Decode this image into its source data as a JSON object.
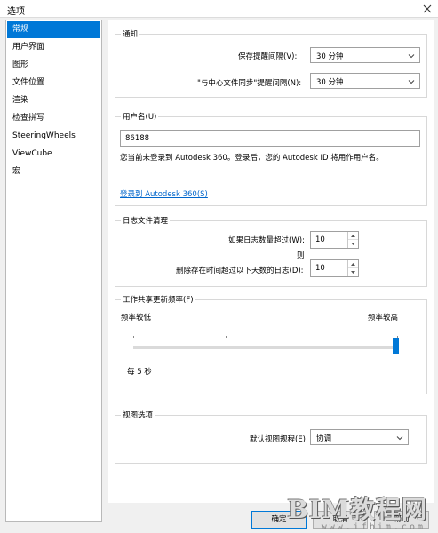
{
  "window": {
    "title": "选项"
  },
  "sidebar": {
    "items": [
      {
        "label": "常规"
      },
      {
        "label": "用户界面"
      },
      {
        "label": "图形"
      },
      {
        "label": "文件位置"
      },
      {
        "label": "渲染"
      },
      {
        "label": "检查拼写"
      },
      {
        "label": "SteeringWheels"
      },
      {
        "label": "ViewCube"
      },
      {
        "label": "宏"
      }
    ],
    "selected": "常规"
  },
  "notify": {
    "title": "通知",
    "save_reminder_label": "保存提醒间隔(V):",
    "save_reminder_value": "30 分钟",
    "sync_reminder_label": "\"与中心文件同步\"提醒间隔(N):",
    "sync_reminder_value": "30 分钟"
  },
  "username": {
    "title": "用户名(U)",
    "value": "86188",
    "message": "您当前未登录到 Autodesk 360。登录后，您的 Autodesk ID 将用作用户名。",
    "login_link": "登录到 Autodesk 360(S)"
  },
  "journal": {
    "title": "日志文件清理",
    "count_label": "如果日志数量超过(W):",
    "count_value": "10",
    "then_label": "则",
    "days_label": "删除存在时间超过以下天数的日志(D):",
    "days_value": "10"
  },
  "worksharing": {
    "title": "工作共享更新频率(F)",
    "low_label": "频率较低",
    "high_label": "频率较高",
    "slider_fraction": 1.0,
    "status": "每 5 秒"
  },
  "view_options": {
    "title": "视图选项",
    "discipline_label": "默认视图规程(E):",
    "discipline_value": "协调"
  },
  "buttons": {
    "ok": "确定",
    "cancel": "取消",
    "help": "帮助"
  },
  "watermark": {
    "main": "BIM教程网",
    "sub": "www.ifbim.com"
  }
}
